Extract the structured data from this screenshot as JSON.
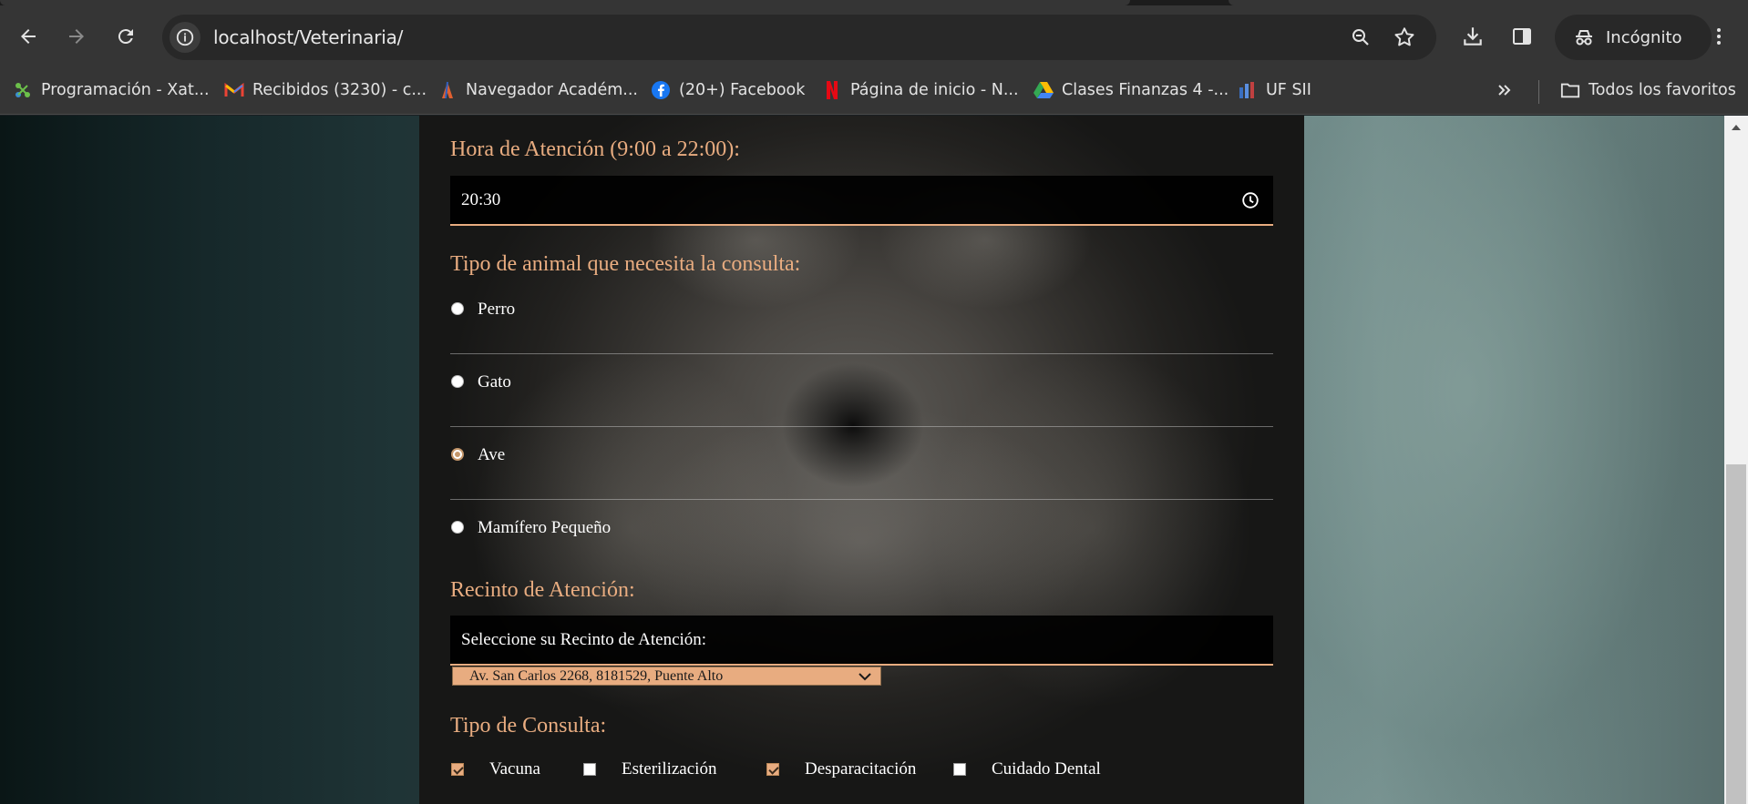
{
  "browser": {
    "url_host": "localhost",
    "url_path": "/Veterinaria/",
    "profile_label": "Incógnito",
    "bookmarks": [
      {
        "label": "Programación - Xat..."
      },
      {
        "label": "Recibidos (3230) - c..."
      },
      {
        "label": "Navegador Académ..."
      },
      {
        "label": "(20+) Facebook"
      },
      {
        "label": "Página de inicio - N..."
      },
      {
        "label": "Clases Finanzas 4 -..."
      },
      {
        "label": "UF SII"
      }
    ],
    "all_bookmarks_label": "Todos los favoritos",
    "icons": [
      "back-icon",
      "forward-icon",
      "reload-icon",
      "site-info-icon",
      "zoom-icon",
      "star-icon",
      "download-icon",
      "side-panel-icon",
      "incognito-icon",
      "menu-icon",
      "chevron-double-right-icon",
      "folder-icon"
    ]
  },
  "form": {
    "time_label": "Hora de Atención (9:00 a 22:00):",
    "time_value": "20:30",
    "animal_label": "Tipo de animal que necesita la consulta:",
    "animals": [
      {
        "label": "Perro",
        "checked": false
      },
      {
        "label": "Gato",
        "checked": false
      },
      {
        "label": "Ave",
        "checked": true
      },
      {
        "label": "Mamífero Pequeño",
        "checked": false
      }
    ],
    "venue_label": "Recinto de Atención:",
    "venue_caption": "Seleccione su Recinto de Atención:",
    "venue_selected": "Av. San Carlos 2268, 8181529, Puente Alto",
    "consult_label": "Tipo de Consulta:",
    "consults": [
      {
        "label": "Vacuna",
        "checked": true
      },
      {
        "label": "Esterilización",
        "checked": false
      },
      {
        "label": "Desparacitación",
        "checked": true
      },
      {
        "label": "Cuidado Dental",
        "checked": false
      }
    ]
  },
  "colors": {
    "accent": "#e8ac80",
    "chrome": "#353535",
    "omnibox": "#282828"
  }
}
